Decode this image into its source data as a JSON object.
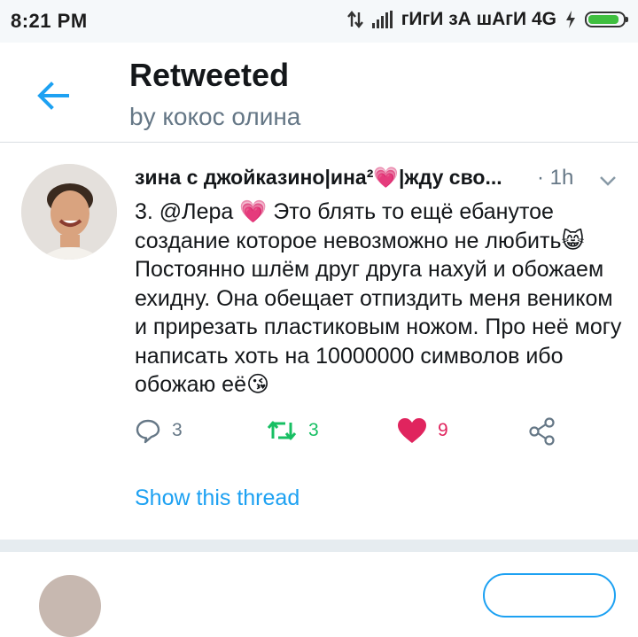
{
  "status_bar": {
    "time": "8:21 PM",
    "network": "гИгИ зА шАгИ 4G",
    "battery_level": 0.9,
    "battery_color": "#3fbf3f"
  },
  "header": {
    "title": "Retweeted",
    "subtitle": "by кокос олина",
    "back_icon": "arrow-left-icon",
    "accent": "#1da1f2"
  },
  "tweet": {
    "author": "зина с джойказино|ина²💗|жду сво...",
    "time": "· 1h",
    "text": "3. @Лера 💗 Это блять то ещё ебанутое создание которое невозможно не любить😸 Постоянно шлём друг друга нахуй и обожаем ехидну. Она обещает отпиздить меня веником и прирезать пластиковым ножом. Про неё могу написать хоть на 10000000 символов ибо обожаю её😘",
    "actions": {
      "reply_count": "3",
      "retweet_count": "3",
      "like_count": "9"
    },
    "show_thread": "Show this thread"
  },
  "colors": {
    "retweet": "#17bf63",
    "like": "#e0245e",
    "muted": "#657786",
    "link": "#1da1f2"
  }
}
